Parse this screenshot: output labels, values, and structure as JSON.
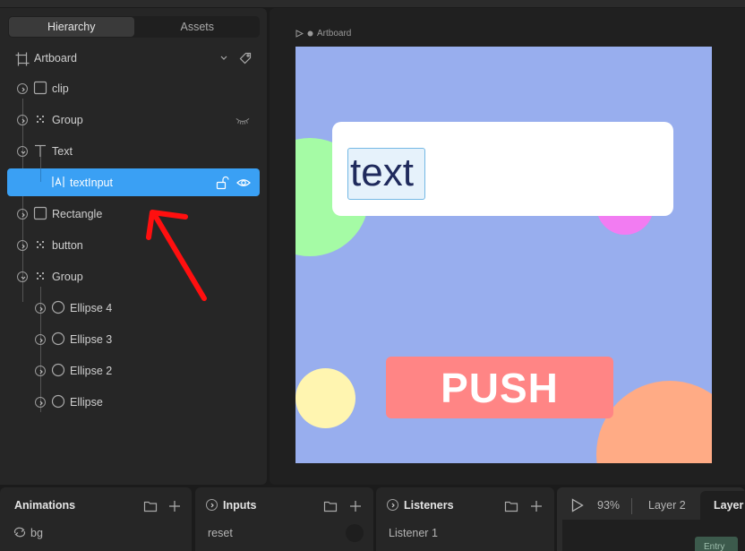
{
  "hierarchy": {
    "tabs": [
      {
        "label": "Hierarchy",
        "active": true
      },
      {
        "label": "Assets",
        "active": false
      }
    ],
    "artboard_label": "Artboard",
    "layers": [
      {
        "label": "clip",
        "icon": "rectangle-icon",
        "depth": 0
      },
      {
        "label": "Group",
        "icon": "group-icon",
        "depth": 0,
        "hidden": true
      },
      {
        "label": "Text",
        "icon": "text-icon",
        "depth": 0,
        "expanded": true
      },
      {
        "label": "textInput",
        "icon": "text-input-icon",
        "depth": 1,
        "selected": true
      },
      {
        "label": "Rectangle",
        "icon": "rectangle-icon",
        "depth": 0
      },
      {
        "label": "button",
        "icon": "group-icon",
        "depth": 0
      },
      {
        "label": "Group",
        "icon": "group-icon",
        "depth": 0,
        "expanded": true
      },
      {
        "label": "Ellipse 4",
        "icon": "ellipse-icon",
        "depth": 1
      },
      {
        "label": "Ellipse 3",
        "icon": "ellipse-icon",
        "depth": 1
      },
      {
        "label": "Ellipse 2",
        "icon": "ellipse-icon",
        "depth": 1
      },
      {
        "label": "Ellipse",
        "icon": "ellipse-icon",
        "depth": 1
      }
    ]
  },
  "canvas": {
    "artboard_caption": "Artboard",
    "text_value": "text",
    "button_label": "PUSH",
    "colors": {
      "artboard": "#98aeee",
      "card": "#ffffff",
      "button": "#ff8585",
      "green": "#a5fba5",
      "pink": "#f27cf2",
      "yellow": "#fff5b0",
      "orange": "#ffab85",
      "selection": "#3aa0f4"
    }
  },
  "bottom": {
    "animations": {
      "title": "Animations",
      "items": [
        "bg"
      ]
    },
    "inputs": {
      "title": "Inputs",
      "items": [
        "reset"
      ]
    },
    "listeners": {
      "title": "Listeners",
      "items": [
        "Listener 1"
      ]
    },
    "timeline": {
      "zoom": "93%",
      "tabs": [
        "Layer 2",
        "Layer"
      ],
      "state_label": "Entry"
    }
  }
}
